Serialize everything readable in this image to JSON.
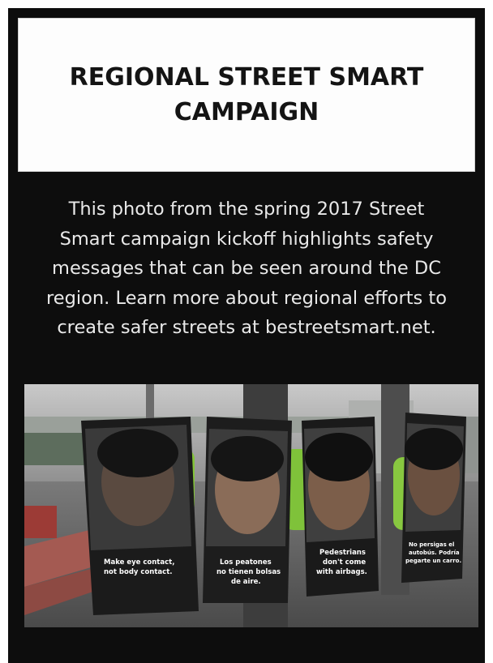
{
  "title": "REGIONAL STREET SMART CAMPAIGN",
  "caption": {
    "line1": "This photo from the spring 2017 Street",
    "line2": "Smart campaign kickoff highlights safety",
    "line3": "messages that can be seen around the DC",
    "line4": "region. Learn more about regional efforts to",
    "line5": "create safer streets at bestreetsmart.net."
  },
  "photo": {
    "posters": [
      {
        "line1": "Make eye contact,",
        "line2": "not body contact."
      },
      {
        "line1": "Los peatones",
        "line2": "no tienen bolsas",
        "line3": "de aire."
      },
      {
        "line1": "Pedestrians",
        "line2": "don't come",
        "line3": "with airbags."
      },
      {
        "line1": "No persigas el",
        "line2": "autobús. Podría",
        "line3": "pegarte un carro."
      }
    ]
  }
}
